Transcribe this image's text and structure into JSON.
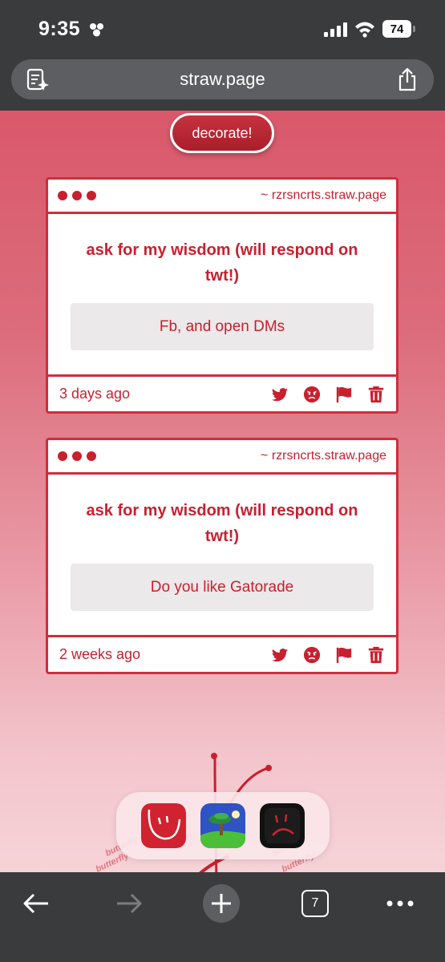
{
  "status_bar": {
    "time": "9:35",
    "battery": "74"
  },
  "url_bar": {
    "url": "straw.page"
  },
  "page": {
    "decorate_label": "decorate!",
    "cards": [
      {
        "domain": "~ rzrsncrts.straw.page",
        "question": "ask for my wisdom (will respond on twt!)",
        "answer": "Fb, and open DMs",
        "time": "3 days ago"
      },
      {
        "domain": "~ rzrsncrts.straw.page",
        "question": "ask for my wisdom (will respond on twt!)",
        "answer": "Do you like Gatorade",
        "time": "2 weeks ago"
      }
    ],
    "decoration_text": "butterfly"
  },
  "toolbar": {
    "tab_count": "7"
  },
  "colors": {
    "accent": "#c8202f",
    "chrome": "#3a3b3d"
  }
}
